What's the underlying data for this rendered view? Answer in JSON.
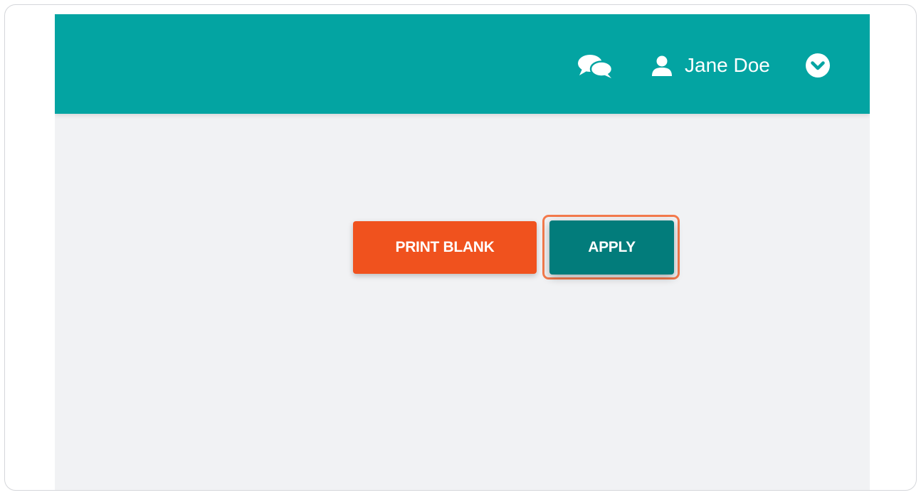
{
  "header": {
    "user_name": "Jane Doe",
    "chat_icon": "chat-bubbles-icon",
    "user_icon": "user-icon",
    "dropdown_icon": "chevron-down-circle-icon"
  },
  "actions": {
    "print_blank_label": "PRINT BLANK",
    "apply_label": "APPLY"
  },
  "colors": {
    "header_bg": "#03a4a2",
    "page_bg": "#f1f2f4",
    "print_button": "#f0521e",
    "apply_button": "#027c7b",
    "highlight": "#f47a4c"
  }
}
